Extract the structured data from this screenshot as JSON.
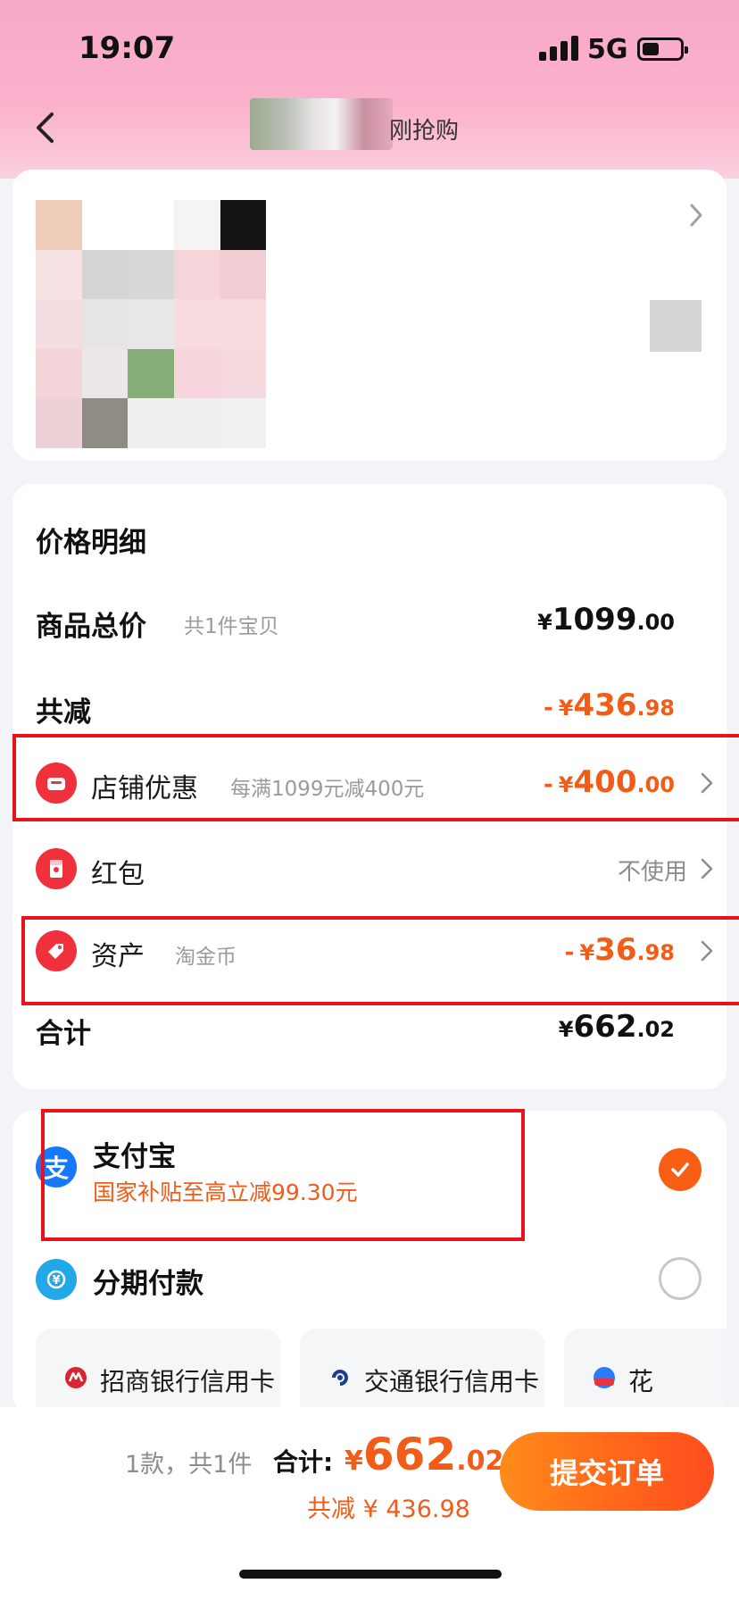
{
  "status_bar": {
    "time": "19:07",
    "network": "5G",
    "battery_level_fraction": 0.45
  },
  "nav": {
    "title_visible": "刚抢购",
    "back_icon": "chevron-left-icon"
  },
  "product_card": {
    "arrow_icon": "chevron-right-icon",
    "image_blurred": true
  },
  "price_detail": {
    "title": "价格明细",
    "goods_total": {
      "label": "商品总价",
      "sub": "共1件宝贝",
      "yen": "¥",
      "int": "1099",
      "dec": ".00"
    },
    "total_discount": {
      "label": "共减",
      "minus": "-",
      "yen": "¥",
      "int": "436",
      "dec": ".98"
    },
    "shop_discount": {
      "label": "店铺优惠",
      "sub": "每满1099元减400元",
      "minus": "-",
      "yen": "¥",
      "int": "400",
      "dec": ".00",
      "icon": "shop-icon"
    },
    "red_packet": {
      "label": "红包",
      "value": "不使用",
      "icon": "red-packet-icon"
    },
    "assets": {
      "label": "资产",
      "sub": "淘金币",
      "minus": "-",
      "yen": "¥",
      "int": "36",
      "dec": ".98",
      "icon": "tag-icon"
    },
    "subtotal": {
      "label": "合计",
      "yen": "¥",
      "int": "662",
      "dec": ".02"
    }
  },
  "payment": {
    "alipay": {
      "icon_char": "支",
      "name": "支付宝",
      "promo": "国家补贴至高立减99.30元",
      "selected": true
    },
    "installment": {
      "name": "分期付款",
      "selected": false
    },
    "banks": [
      {
        "label": "招商银行信用卡",
        "icon": "cmb-bank-icon"
      },
      {
        "label": "交通银行信用卡",
        "icon": "bocom-bank-icon"
      },
      {
        "label": "花",
        "icon": "huabei-installment-icon"
      }
    ]
  },
  "bottom_bar": {
    "count": "1款，共1件",
    "total_label": "合计:",
    "total_yen": "¥",
    "total_int": "662",
    "total_dec": ".02",
    "saved": "共减 ¥ 436.98",
    "submit_label": "提交订单"
  },
  "colors": {
    "accent_orange": "#f25c19",
    "highlight_red": "#e6141a",
    "alipay_blue": "#1677ff",
    "header_pink": "#fbb2cd"
  }
}
